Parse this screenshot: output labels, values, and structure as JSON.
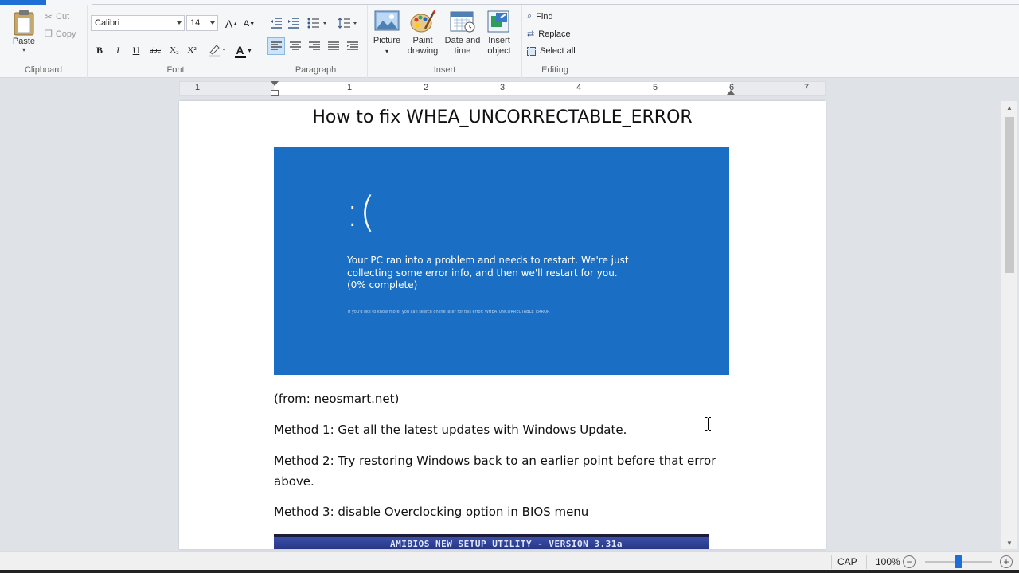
{
  "ribbon": {
    "clipboard": {
      "label": "Clipboard",
      "paste": "Paste",
      "cut": "Cut",
      "copy": "Copy"
    },
    "font": {
      "label": "Font",
      "family": "Calibri",
      "size": "14",
      "bold": "B",
      "italic": "I",
      "underline": "U",
      "strike": "abc",
      "subscript": "X₂",
      "superscript": "X²",
      "font_color_glyph": "A",
      "grow_glyph": "A",
      "shrink_glyph": "A"
    },
    "paragraph": {
      "label": "Paragraph"
    },
    "insert": {
      "label": "Insert",
      "picture": "Picture",
      "paint_drawing_1": "Paint",
      "paint_drawing_2": "drawing",
      "date_time_1": "Date and",
      "date_time_2": "time",
      "insert_object_1": "Insert",
      "insert_object_2": "object"
    },
    "editing": {
      "label": "Editing",
      "find": "Find",
      "replace": "Replace",
      "select_all": "Select all"
    }
  },
  "ruler": {
    "numbers": [
      "1",
      "1",
      "2",
      "3",
      "4",
      "5",
      "6",
      "7"
    ]
  },
  "document": {
    "title": "How to fix WHEA_UNCORRECTABLE_ERROR",
    "bsod": {
      "face": ":(",
      "message": "Your PC ran into a problem and needs to restart. We're just collecting some error info, and then we'll restart for you. (0% complete)",
      "stop_line": "If you'd like to know more, you can search online later for this error: WHEA_UNCORRECTABLE_ERROR"
    },
    "paragraphs": [
      "(from: neosmart.net)",
      "Method 1: Get all the latest updates with Windows Update.",
      "Method 2: Try restoring Windows back to an earlier point before that error above.",
      "Method 3: disable Overclocking option in BIOS menu"
    ],
    "bios_banner": "AMIBIOS NEW SETUP UTILITY - VERSION 3.31a"
  },
  "statusbar": {
    "caps": "CAP",
    "zoom": "100%",
    "zoom_out": "−",
    "zoom_in": "+",
    "zoom_level": 0.5
  },
  "colors": {
    "accent": "#1d6fd6",
    "bsod_blue": "#1a6fc4",
    "ribbon_bg": "#f5f6f7"
  }
}
